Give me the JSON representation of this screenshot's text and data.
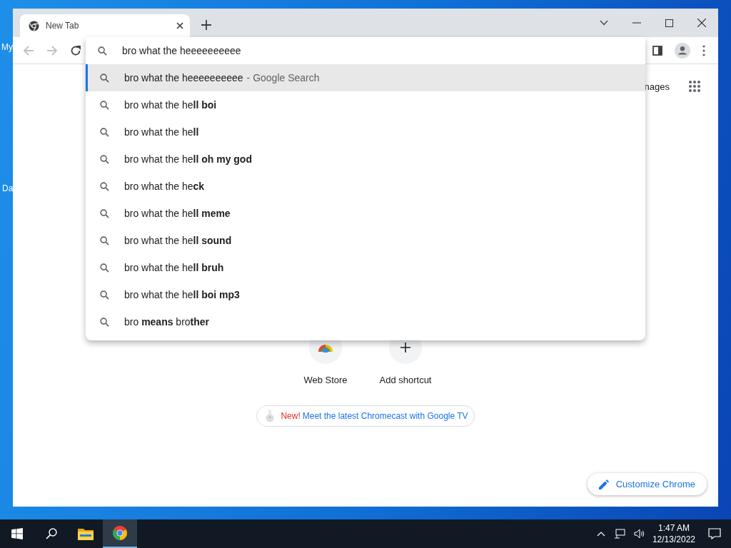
{
  "desktop": {
    "icon_labels": [
      "My",
      "Da"
    ]
  },
  "browser": {
    "tabs": [
      {
        "title": "New Tab",
        "selected": true
      }
    ],
    "toolbar": {
      "back_disabled": true,
      "forward_disabled": true
    },
    "omnibox": {
      "value": "bro what the heeeeeeeeee"
    },
    "suggestions": [
      {
        "text": "bro what the heeeeeeeeee",
        "suffix": "- Google Search",
        "selected": true
      },
      {
        "text": "bro what the he**ll boi**",
        "selected": false
      },
      {
        "text": "bro what the he**ll**",
        "selected": false
      },
      {
        "text": "bro what the he**ll oh my god**",
        "selected": false
      },
      {
        "text": "bro what the he**ck**",
        "selected": false
      },
      {
        "text": "bro what the he**ll meme**",
        "selected": false
      },
      {
        "text": "bro what the he**ll sound**",
        "selected": false
      },
      {
        "text": "bro what the he**ll bruh**",
        "selected": false
      },
      {
        "text": "bro what the he**ll boi mp3**",
        "selected": false
      },
      {
        "text": "bro **means** bro**ther**",
        "selected": false
      }
    ],
    "page": {
      "top_link": "nages",
      "shortcuts": [
        {
          "label": "Web Store",
          "kind": "store"
        },
        {
          "label": "Add shortcut",
          "kind": "add"
        }
      ],
      "promo": {
        "badge": "New!",
        "text": "Meet the latest Chromecast with Google TV"
      },
      "customize_button": "Customize Chrome"
    }
  },
  "taskbar": {
    "apps": [
      {
        "kind": "explorer",
        "selected": false
      },
      {
        "kind": "chrome",
        "selected": true
      }
    ],
    "time": "1:47 AM",
    "date": "12/13/2022"
  }
}
